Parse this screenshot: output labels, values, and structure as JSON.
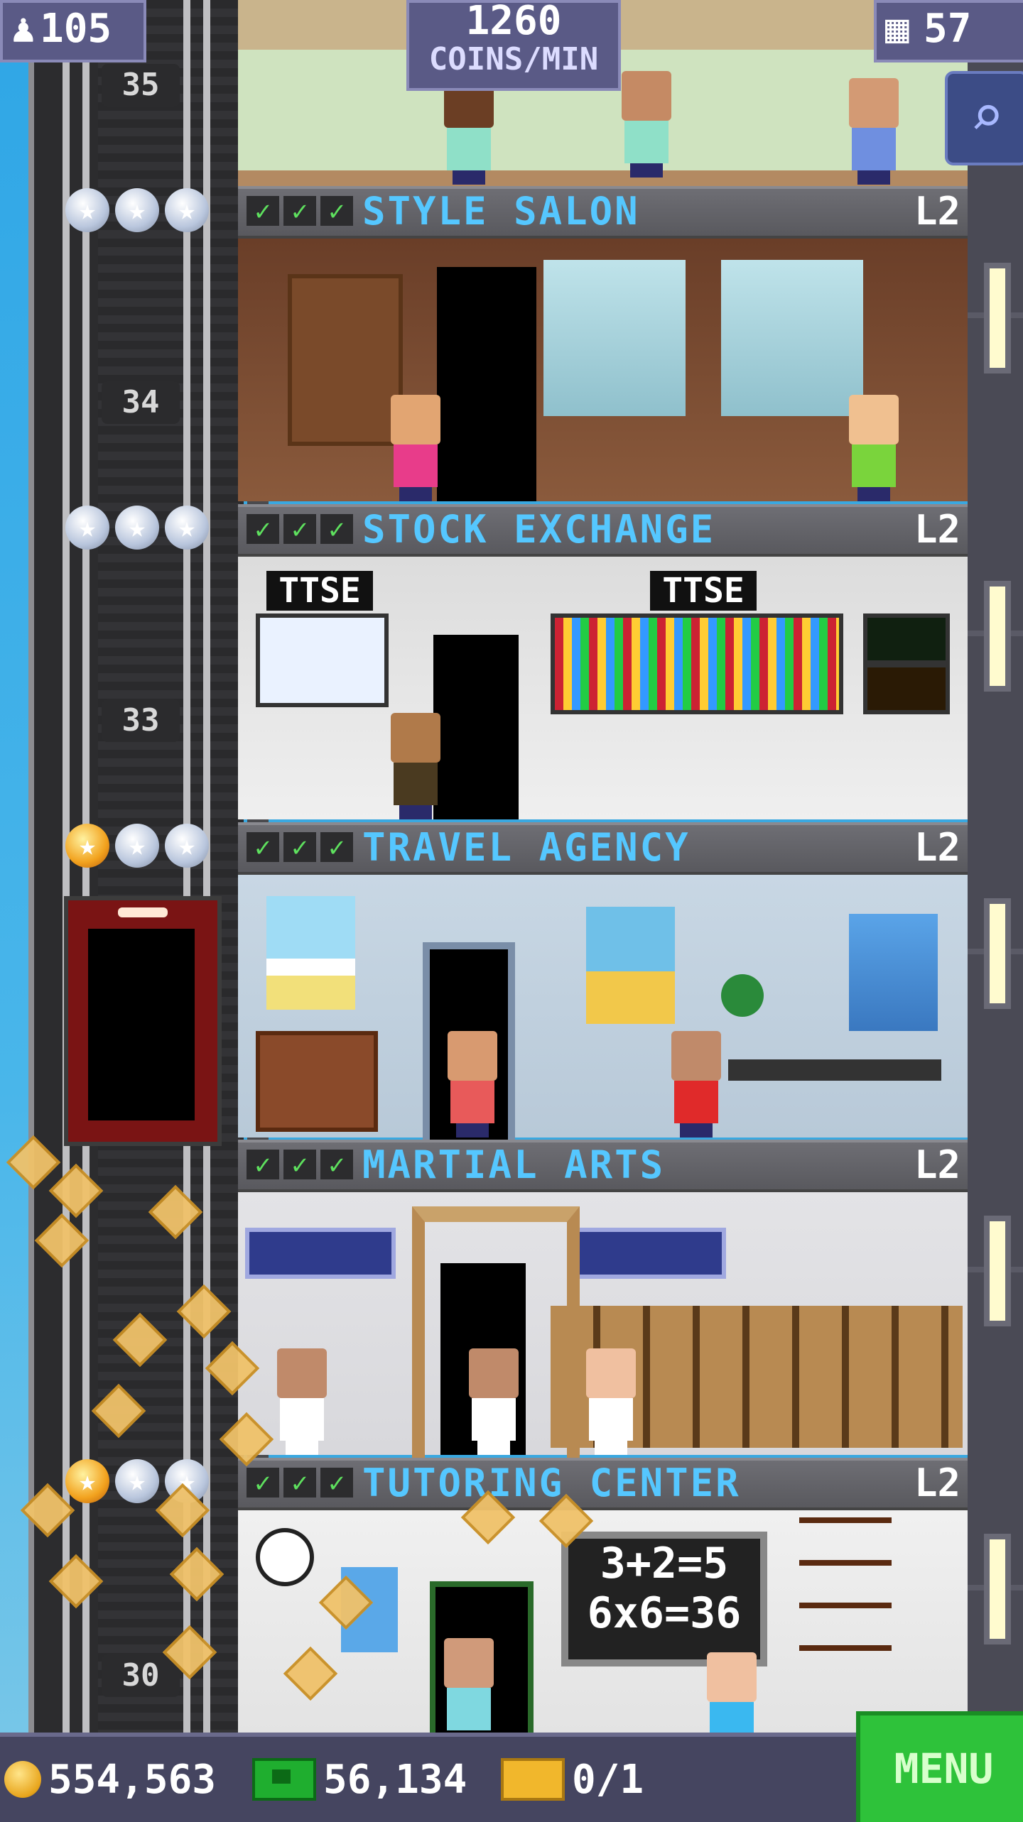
{
  "top_bar": {
    "population": "105",
    "coins_per_min_value": "1260",
    "coins_per_min_label": "COINS/MIN",
    "floors_count": "57"
  },
  "elevator": {
    "floor_numbers": [
      "35",
      "34",
      "33",
      "30"
    ]
  },
  "floors": [
    {
      "name": "STYLE SALON",
      "level": "L2"
    },
    {
      "name": "STOCK EXCHANGE",
      "level": "L2",
      "signs": [
        "TTSE",
        "TTSE"
      ]
    },
    {
      "name": "TRAVEL AGENCY",
      "level": "L2"
    },
    {
      "name": "MARTIAL ARTS",
      "level": "L2"
    },
    {
      "name": "TUTORING CENTER",
      "level": "L2",
      "board_lines": [
        "3+2=5",
        "6x6=36"
      ]
    }
  ],
  "bottom_bar": {
    "coins": "554,563",
    "bux": "56,134",
    "tickets": "0/1",
    "menu_label": "MENU"
  },
  "colors": {
    "floor_name": "#55c7ff",
    "menu_green": "#2ec23a",
    "sky": "#3aa8e0"
  },
  "icons": [
    "person-icon",
    "building-icon",
    "search-icon",
    "coin-icon",
    "bux-icon",
    "ticket-icon",
    "star-icon",
    "check-icon"
  ]
}
